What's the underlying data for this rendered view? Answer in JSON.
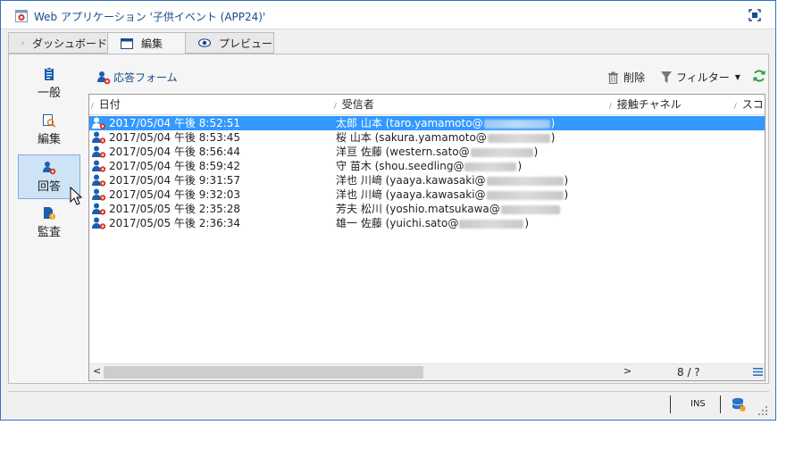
{
  "window": {
    "title": "Web アプリケーション '子供イベント (APP24)'"
  },
  "tabs": [
    {
      "label": "ダッシュボード"
    },
    {
      "label": "編集"
    },
    {
      "label": "プレビュー"
    }
  ],
  "nav": [
    {
      "label": "一般"
    },
    {
      "label": "編集"
    },
    {
      "label": "回答"
    },
    {
      "label": "監査"
    }
  ],
  "toolbar": {
    "form_label": "応答フォーム",
    "delete_label": "削除",
    "filter_label": "フィルター"
  },
  "grid": {
    "columns": [
      "日付",
      "受信者",
      "接触チャネル",
      "スコ"
    ],
    "rows": [
      {
        "date": "2017/05/04 午後 8:52:51",
        "recipient": "太郎 山本 (taro.yamamoto@",
        "suffix": ")",
        "selected": true
      },
      {
        "date": "2017/05/04 午後 8:53:45",
        "recipient": "桜 山本 (sakura.yamamoto@",
        "suffix": ")"
      },
      {
        "date": "2017/05/04 午後 8:56:44",
        "recipient": "洋亘 佐藤 (western.sato@",
        "suffix": ")"
      },
      {
        "date": "2017/05/04 午後 8:59:42",
        "recipient": "守 苗木 (shou.seedling@",
        "suffix": ")"
      },
      {
        "date": "2017/05/04 午後 9:31:57",
        "recipient": "洋也 川﨑 (yaaya.kawasaki@",
        "suffix": ")"
      },
      {
        "date": "2017/05/04 午後 9:32:03",
        "recipient": "洋也 川﨑 (yaaya.kawasaki@",
        "suffix": ")"
      },
      {
        "date": "2017/05/05 午後 2:35:28",
        "recipient": "芳夫 松川 (yoshio.matsukawa@",
        "suffix": ""
      },
      {
        "date": "2017/05/05 午後 2:36:34",
        "recipient": "雄一 佐藤 (yuichi.sato@",
        "suffix": ")"
      }
    ],
    "pager": "8 / ?"
  },
  "statusbar": {
    "ins": "INS"
  },
  "colors": {
    "accent": "#1a4a8a",
    "selection": "#3399ff",
    "brand_red": "#d9382c",
    "refresh_green": "#2e9e3c"
  }
}
